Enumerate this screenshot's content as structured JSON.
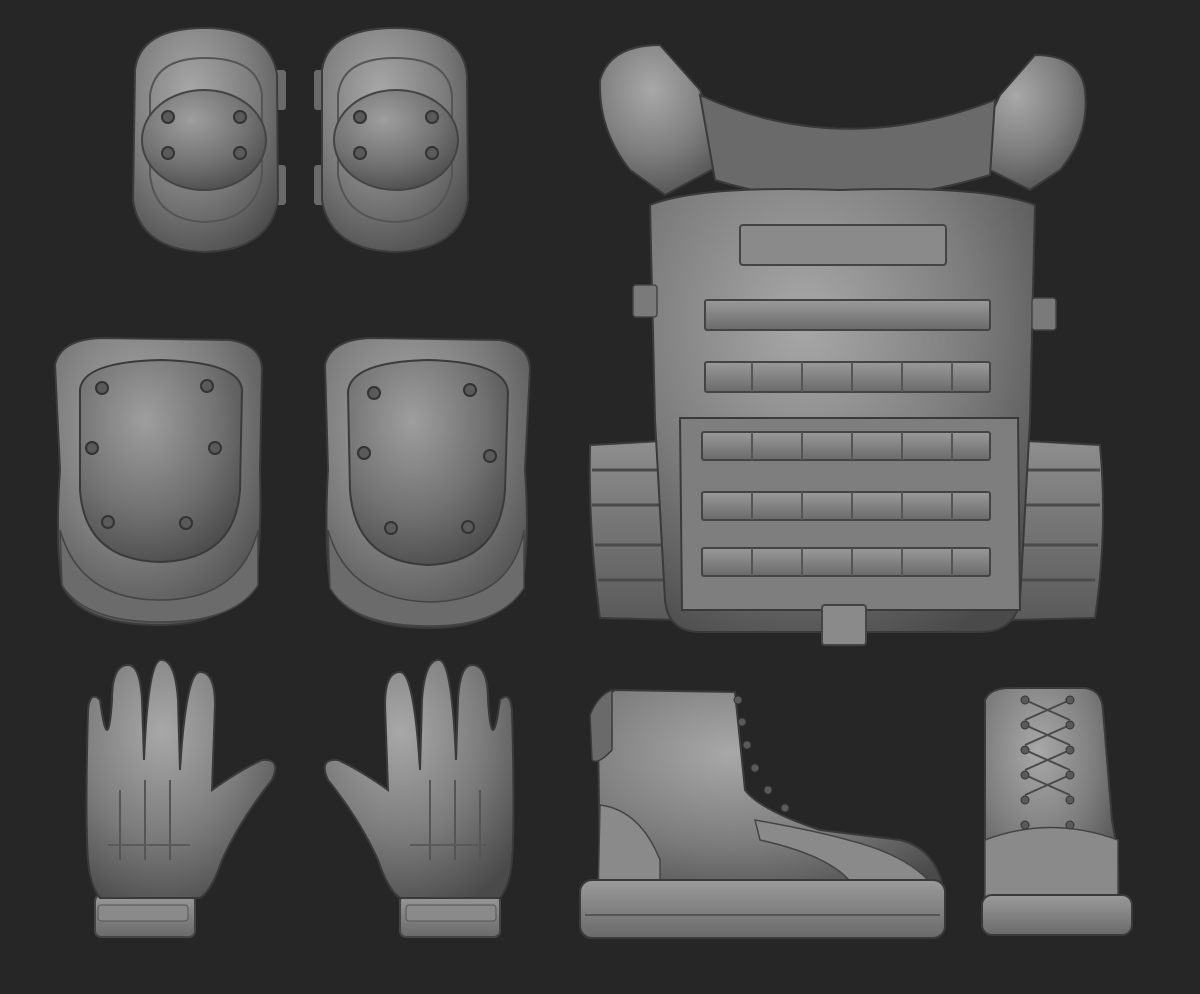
{
  "scene": {
    "background": "#262626",
    "clay_base": "#7a7a7a",
    "clay_light": "#a6a6a6",
    "clay_dark": "#3e3e3e",
    "items": [
      {
        "name": "elbow-pad",
        "count": 2
      },
      {
        "name": "knee-pad",
        "count": 2
      },
      {
        "name": "glove",
        "count": 2
      },
      {
        "name": "plate-carrier-vest",
        "count": 1
      },
      {
        "name": "combat-boot",
        "count": 2
      }
    ]
  }
}
